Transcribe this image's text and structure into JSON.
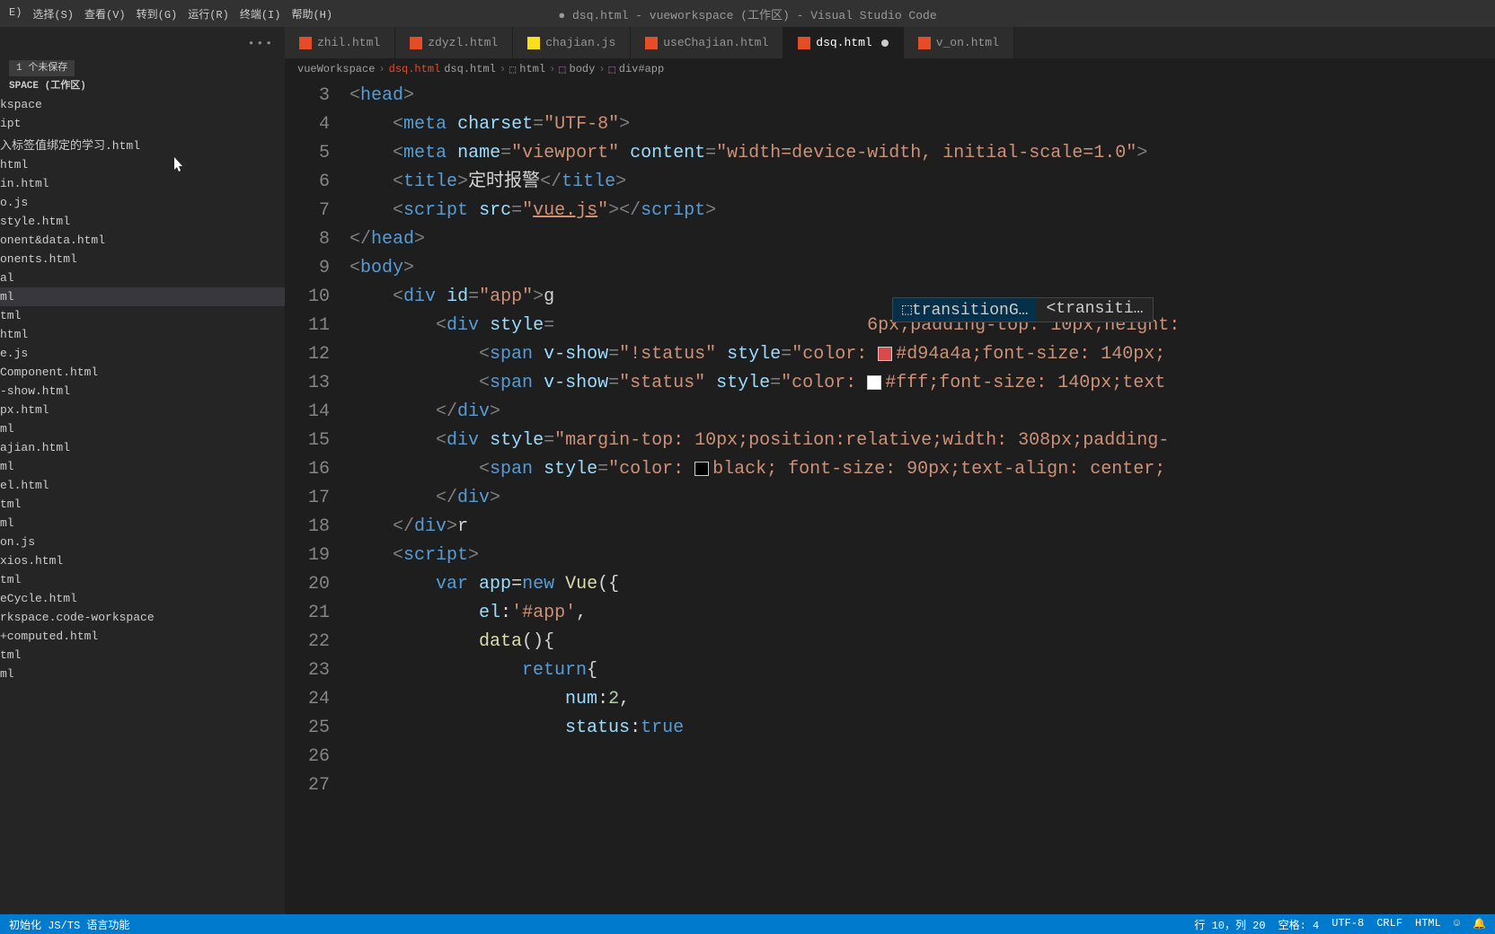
{
  "title": "● dsq.html - vueworkspace (工作区) - Visual Studio Code",
  "menu": [
    "E)",
    "选择(S)",
    "查看(V)",
    "转到(G)",
    "运行(R)",
    "终端(I)",
    "帮助(H)"
  ],
  "unsaved": "1 个未保存",
  "workspace": "SPACE (工作区)",
  "workspaceSub": "kspace",
  "files": [
    "ipt",
    "入标签值绑定的学习.html",
    "html",
    "in.html",
    "o.js",
    "style.html",
    "onent&data.html",
    "onents.html",
    "al",
    "ml",
    "tml",
    "html",
    "e.js",
    "Component.html",
    "-show.html",
    "px.html",
    "ml",
    "ajian.html",
    "ml",
    "el.html",
    "tml",
    "ml",
    "on.js",
    "xios.html",
    "tml",
    "eCycle.html",
    "rkspace.code-workspace",
    "+computed.html",
    "tml",
    "ml"
  ],
  "selectedFileIndex": 9,
  "tabs": [
    {
      "icon": "html",
      "label": "zhil.html",
      "active": false,
      "dirty": false
    },
    {
      "icon": "html",
      "label": "zdyzl.html",
      "active": false,
      "dirty": false
    },
    {
      "icon": "js",
      "label": "chajian.js",
      "active": false,
      "dirty": false
    },
    {
      "icon": "html",
      "label": "useChajian.html",
      "active": false,
      "dirty": false
    },
    {
      "icon": "html",
      "label": "dsq.html",
      "active": true,
      "dirty": true
    },
    {
      "icon": "html",
      "label": "v_on.html",
      "active": false,
      "dirty": false
    }
  ],
  "crumbs": [
    "vueWorkspace",
    "dsq.html",
    "html",
    "body",
    "div#app"
  ],
  "lineStart": 3,
  "code": {
    "l3": {
      "pre": "  ",
      "t1": "<head>"
    },
    "l4": {
      "pre": "      ",
      "t": "meta",
      "a": "charset",
      "s": "\"UTF-8\""
    },
    "l5": {
      "pre": "      ",
      "t": "meta",
      "a1": "name",
      "s1": "\"viewport\"",
      "a2": "content",
      "s2": "\"width=device-width, initial-scale=1.0\""
    },
    "l6": {
      "pre": "      ",
      "t": "title",
      "txt": "定时报警"
    },
    "l7": {
      "pre": "      ",
      "t": "script",
      "a": "src",
      "s": "vue.js"
    },
    "l8": {
      "pre": "  ",
      "t": "</head>"
    },
    "l9": {
      "pre": "  ",
      "t": "<body>"
    },
    "l10": {
      "pre": "      ",
      "t": "div",
      "a": "id",
      "s": "\"app\"",
      "after": "g"
    },
    "l11": {
      "pre": "          ",
      "t": "div",
      "a": "style",
      "rest": "6px;padding-top: 10px;height:"
    },
    "l12": {
      "pre": "              ",
      "t": "span",
      "a": "v-show",
      "s": "\"!status\"",
      "a2": "style",
      "s2": "\"color: ",
      "col": "#d94a4a",
      "rest": ";font-size: 140px;"
    },
    "l13": {
      "pre": "              ",
      "t": "span",
      "a": "v-show",
      "s": "\"status\"",
      "a2": "style",
      "s2": "\"color: ",
      "col": "#fff",
      "rest": ";font-size: 140px;text"
    },
    "l14": {
      "pre": "          ",
      "t": "</div>"
    },
    "l15": {
      "pre": "          ",
      "t": "div",
      "a": "style",
      "s": "\"margin-top: 10px;position:relative;width: 308px;padding-"
    },
    "l16": {
      "pre": "              ",
      "t": "span",
      "a": "style",
      "s": "\"color: ",
      "col": "black",
      "rest": "; font-size: 90px;text-align: center;"
    },
    "l17": {
      "pre": "          ",
      "t": "</div>"
    },
    "l18": {
      "pre": ""
    },
    "l19": {
      "pre": ""
    },
    "l20": {
      "pre": "      ",
      "t": "</div>",
      "after": "r"
    },
    "l21": {
      "pre": "      ",
      "t": "<script>"
    },
    "l22": {
      "pre": "          ",
      "k": "var",
      "v": "app",
      "n": "new",
      "cls": "Vue"
    },
    "l23": {
      "pre": "              ",
      "prop": "el",
      "val": "'#app'"
    },
    "l24": {
      "pre": "              ",
      "fn": "data"
    },
    "l25": {
      "pre": "                  ",
      "k": "return"
    },
    "l26": {
      "pre": "                      ",
      "prop": "num",
      "val": "2"
    },
    "l27": {
      "pre": "                      ",
      "prop": "status",
      "val": "true"
    }
  },
  "suggest": {
    "item1": "transitionG…",
    "item2": "<transiti…"
  },
  "statusLeft": "初始化 JS/TS 语言功能",
  "statusRight": [
    "行 10，列 20",
    "空格: 4",
    "UTF-8",
    "CRLF",
    "HTML"
  ]
}
